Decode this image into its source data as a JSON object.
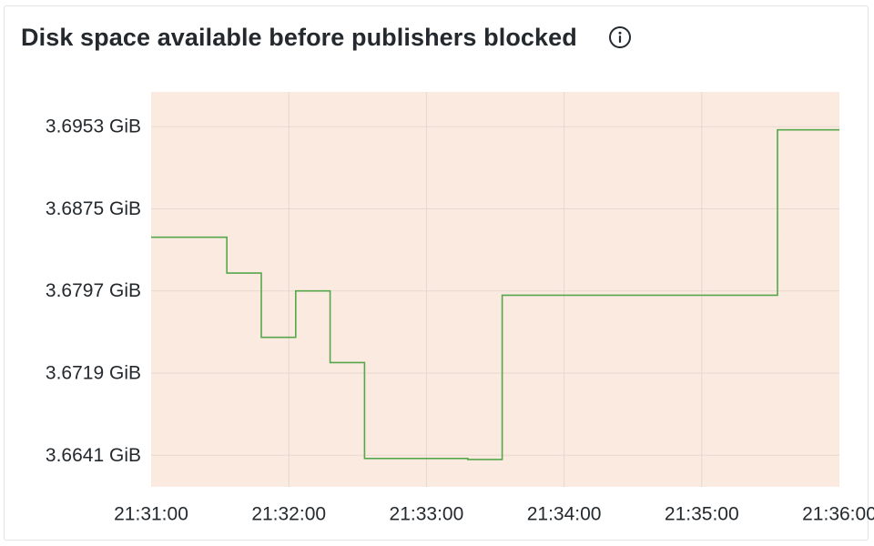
{
  "panel": {
    "title": "Disk space available before publishers blocked",
    "info_icon": "info-circle-icon"
  },
  "colors": {
    "plot_background": "#fbeae0",
    "line": "#56a64b",
    "grid": "#e6d8d0",
    "text": "#24292e"
  },
  "chart_data": {
    "type": "line",
    "interpolation": "step-after",
    "title": "Disk space available before publishers blocked",
    "xlabel": "",
    "ylabel": "",
    "y_unit": "GiB",
    "x_ticks": [
      "21:31:00",
      "21:32:00",
      "21:33:00",
      "21:34:00",
      "21:35:00",
      "21:36:00"
    ],
    "y_ticks": [
      "3.6953 GiB",
      "3.6875 GiB",
      "3.6797 GiB",
      "3.6719 GiB",
      "3.6641 GiB"
    ],
    "y_tick_values": [
      3.6953,
      3.6875,
      3.6797,
      3.6719,
      3.6641
    ],
    "xlim": [
      "21:31:00",
      "21:36:00"
    ],
    "ylim": [
      3.6611,
      3.6986
    ],
    "grid": true,
    "legend": "none",
    "series": [
      {
        "x": [
          "21:31:00",
          "21:31:33",
          "21:31:48",
          "21:32:03",
          "21:32:18",
          "21:32:33",
          "21:33:18",
          "21:33:33",
          "21:34:00",
          "21:35:00",
          "21:35:33",
          "21:36:00"
        ],
        "y": [
          3.6848,
          3.6814,
          3.6753,
          3.6797,
          3.6729,
          3.6638,
          3.6637,
          3.6793,
          3.6793,
          3.6793,
          3.695,
          3.695
        ]
      }
    ]
  }
}
